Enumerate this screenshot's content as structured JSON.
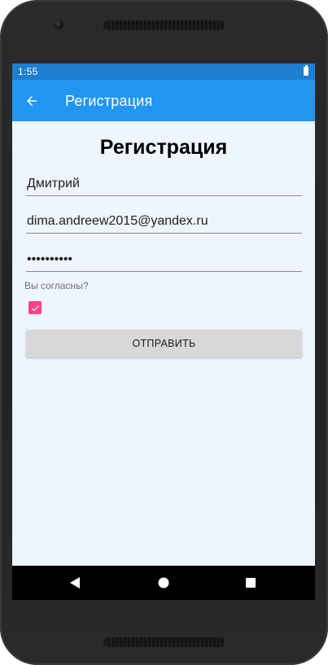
{
  "status_bar": {
    "time": "1:55",
    "battery_icon": "battery-full-icon"
  },
  "app_bar": {
    "title": "Регистрация",
    "back_icon": "arrow-left-icon"
  },
  "form": {
    "heading": "Регистрация",
    "name_value": "Дмитрий",
    "email_value": "dima.andreew2015@yandex.ru",
    "password_value": "1234567890",
    "agree_label": "Вы согласны?",
    "agree_checked": true,
    "submit_label": "ОТПРАВИТЬ"
  },
  "nav_bar": {
    "back_icon": "nav-back-triangle-icon",
    "home_icon": "nav-home-circle-icon",
    "recents_icon": "nav-recents-square-icon"
  },
  "colors": {
    "status_bar": "#1e7fd0",
    "app_bar": "#2196f3",
    "background": "#eef5fd",
    "checkbox_accent": "#ff4081",
    "button": "#d8d8d8"
  }
}
